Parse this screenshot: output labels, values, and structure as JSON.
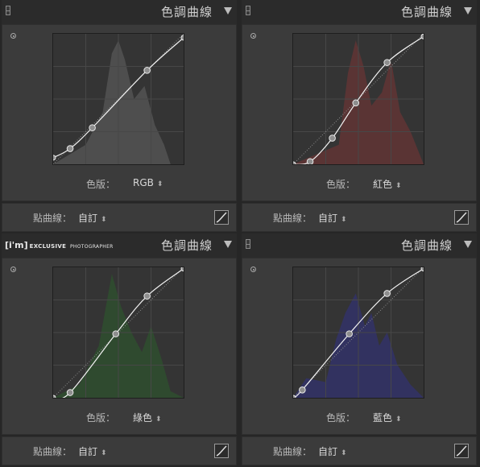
{
  "panels": [
    {
      "title": "色調曲線",
      "channel_label": "色版：",
      "channel_value": "RGB",
      "point_curve_label": "點曲線：",
      "point_curve_value": "自訂",
      "histogram_color": "#4e4e4e",
      "curve_points": [
        [
          0,
          0.05
        ],
        [
          0.13,
          0.12
        ],
        [
          0.3,
          0.28
        ],
        [
          0.72,
          0.72
        ],
        [
          1,
          0.97
        ]
      ]
    },
    {
      "title": "色調曲線",
      "channel_label": "色版：",
      "channel_value": "紅色",
      "point_curve_label": "點曲線：",
      "point_curve_value": "自訂",
      "histogram_color": "#5a3434",
      "curve_points": [
        [
          0,
          0
        ],
        [
          0.13,
          0.02
        ],
        [
          0.3,
          0.2
        ],
        [
          0.48,
          0.47
        ],
        [
          0.72,
          0.78
        ],
        [
          1,
          0.98
        ]
      ]
    },
    {
      "title": "色調曲線",
      "channel_label": "色版：",
      "channel_value": "綠色",
      "point_curve_label": "點曲線：",
      "point_curve_value": "自訂",
      "histogram_color": "#2f4a2f",
      "curve_points": [
        [
          0,
          0
        ],
        [
          0.13,
          0.04
        ],
        [
          0.48,
          0.49
        ],
        [
          0.72,
          0.78
        ],
        [
          1,
          0.99
        ]
      ],
      "logo": {
        "brand": "[i'm]",
        "exclusive": "EXCLUSIVE",
        "photographer": "PHOTOGRAPHER"
      }
    },
    {
      "title": "色調曲線",
      "channel_label": "色版：",
      "channel_value": "藍色",
      "point_curve_label": "點曲線：",
      "point_curve_value": "自訂",
      "histogram_color": "#323260",
      "curve_points": [
        [
          0,
          0
        ],
        [
          0.07,
          0.06
        ],
        [
          0.43,
          0.49
        ],
        [
          0.72,
          0.8
        ],
        [
          1,
          0.99
        ]
      ]
    }
  ]
}
